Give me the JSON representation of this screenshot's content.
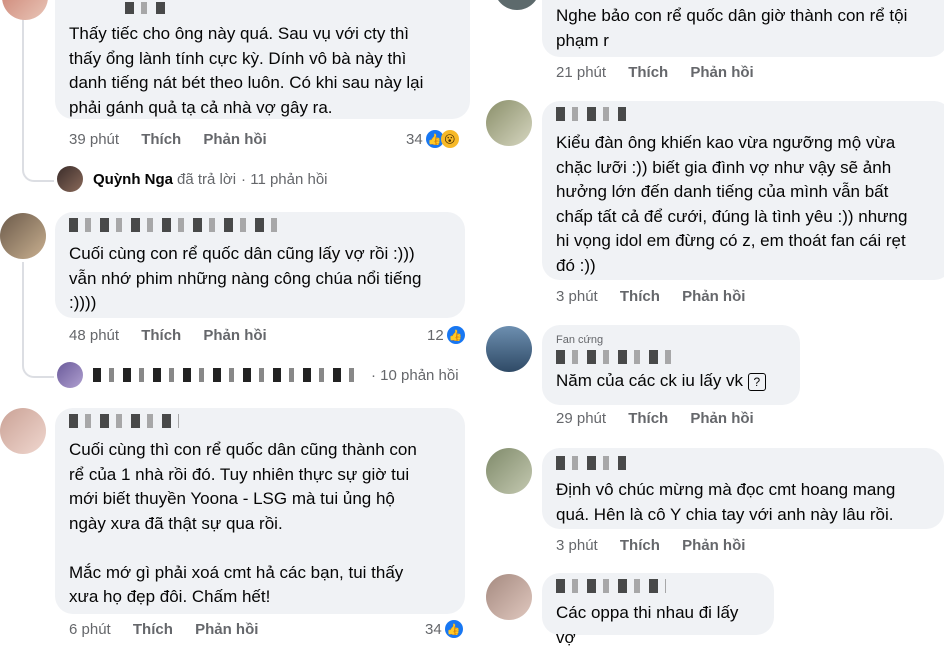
{
  "left": {
    "c1": {
      "text": "Thấy tiếc cho ông này quá. Sau vụ với cty thì\nthấy ổng lành tính cực kỳ. Dính vô bà này thì\ndanh tiếng nát bét theo luôn. Có khi sau này lại\nphải gánh quả tạ cả nhà vợ gây ra.",
      "time": "39 phút",
      "like": "Thích",
      "reply": "Phản hồi",
      "count": "34"
    },
    "reply_summary_1": {
      "name": "Quỳnh Nga",
      "action": "đã trả lời",
      "count": "· 11 phản hồi"
    },
    "c2": {
      "text": "Cuối cùng con rể quốc dân cũng lấy vợ rồi :)))\nvẫn nhớ phim những nàng công chúa nổi tiếng\n:))))",
      "time": "48 phút",
      "like": "Thích",
      "reply": "Phản hồi",
      "count": "12"
    },
    "reply_summary_2": {
      "count": "· 10 phản hồi"
    },
    "c3": {
      "text": "Cuối cùng thì con rể quốc dân cũng thành con\nrể của 1 nhà rồi đó. Tuy nhiên thực sự giờ tui\nmới biết thuyền Yoona - LSG mà tui ủng hộ\nngày xưa đã thật sự qua rồi.\n\nMắc mớ gì phải xoá cmt hả các bạn, tui thấy\nxưa họ đẹp đôi. Chấm hết!",
      "time": "6 phút",
      "like": "Thích",
      "reply": "Phản hồi",
      "count": "34"
    }
  },
  "right": {
    "r1": {
      "text": "Nghe bảo con rể quốc dân giờ thành con rể tội\nphạm r",
      "time": "21 phút",
      "like": "Thích",
      "reply": "Phản hồi"
    },
    "r2": {
      "text": "Kiểu đàn ông khiến kao vừa ngưỡng mộ vừa\nchặc lưỡi :)) biết gia đình vợ như vậy sẽ ảnh\nhưởng lớn đến danh tiếng của mình vẫn bất\nchấp tất cả để cưới, đúng là tình yêu :)) nhưng\nhi vọng idol em đừng có z, em thoát fan cái rẹt\nđó :))",
      "time": "3 phút",
      "like": "Thích",
      "reply": "Phản hồi"
    },
    "r3": {
      "tag": "Fan cứng",
      "text": "Năm của các ck iu lấy vk",
      "time": "29 phút",
      "like": "Thích",
      "reply": "Phản hồi"
    },
    "r4": {
      "text": "Định vô chúc mừng mà đọc cmt hoang mang\nquá. Hên là cô Y chia tay với anh này lâu rồi.",
      "time": "3 phút",
      "like": "Thích",
      "reply": "Phản hồi"
    },
    "r5": {
      "text": "Các oppa thi nhau đi lấy vợ"
    }
  },
  "colors": {
    "bubble": "#f0f2f5",
    "meta": "#65676b",
    "like_blue": "#1877f2",
    "wow_yellow": "#f7b928"
  }
}
